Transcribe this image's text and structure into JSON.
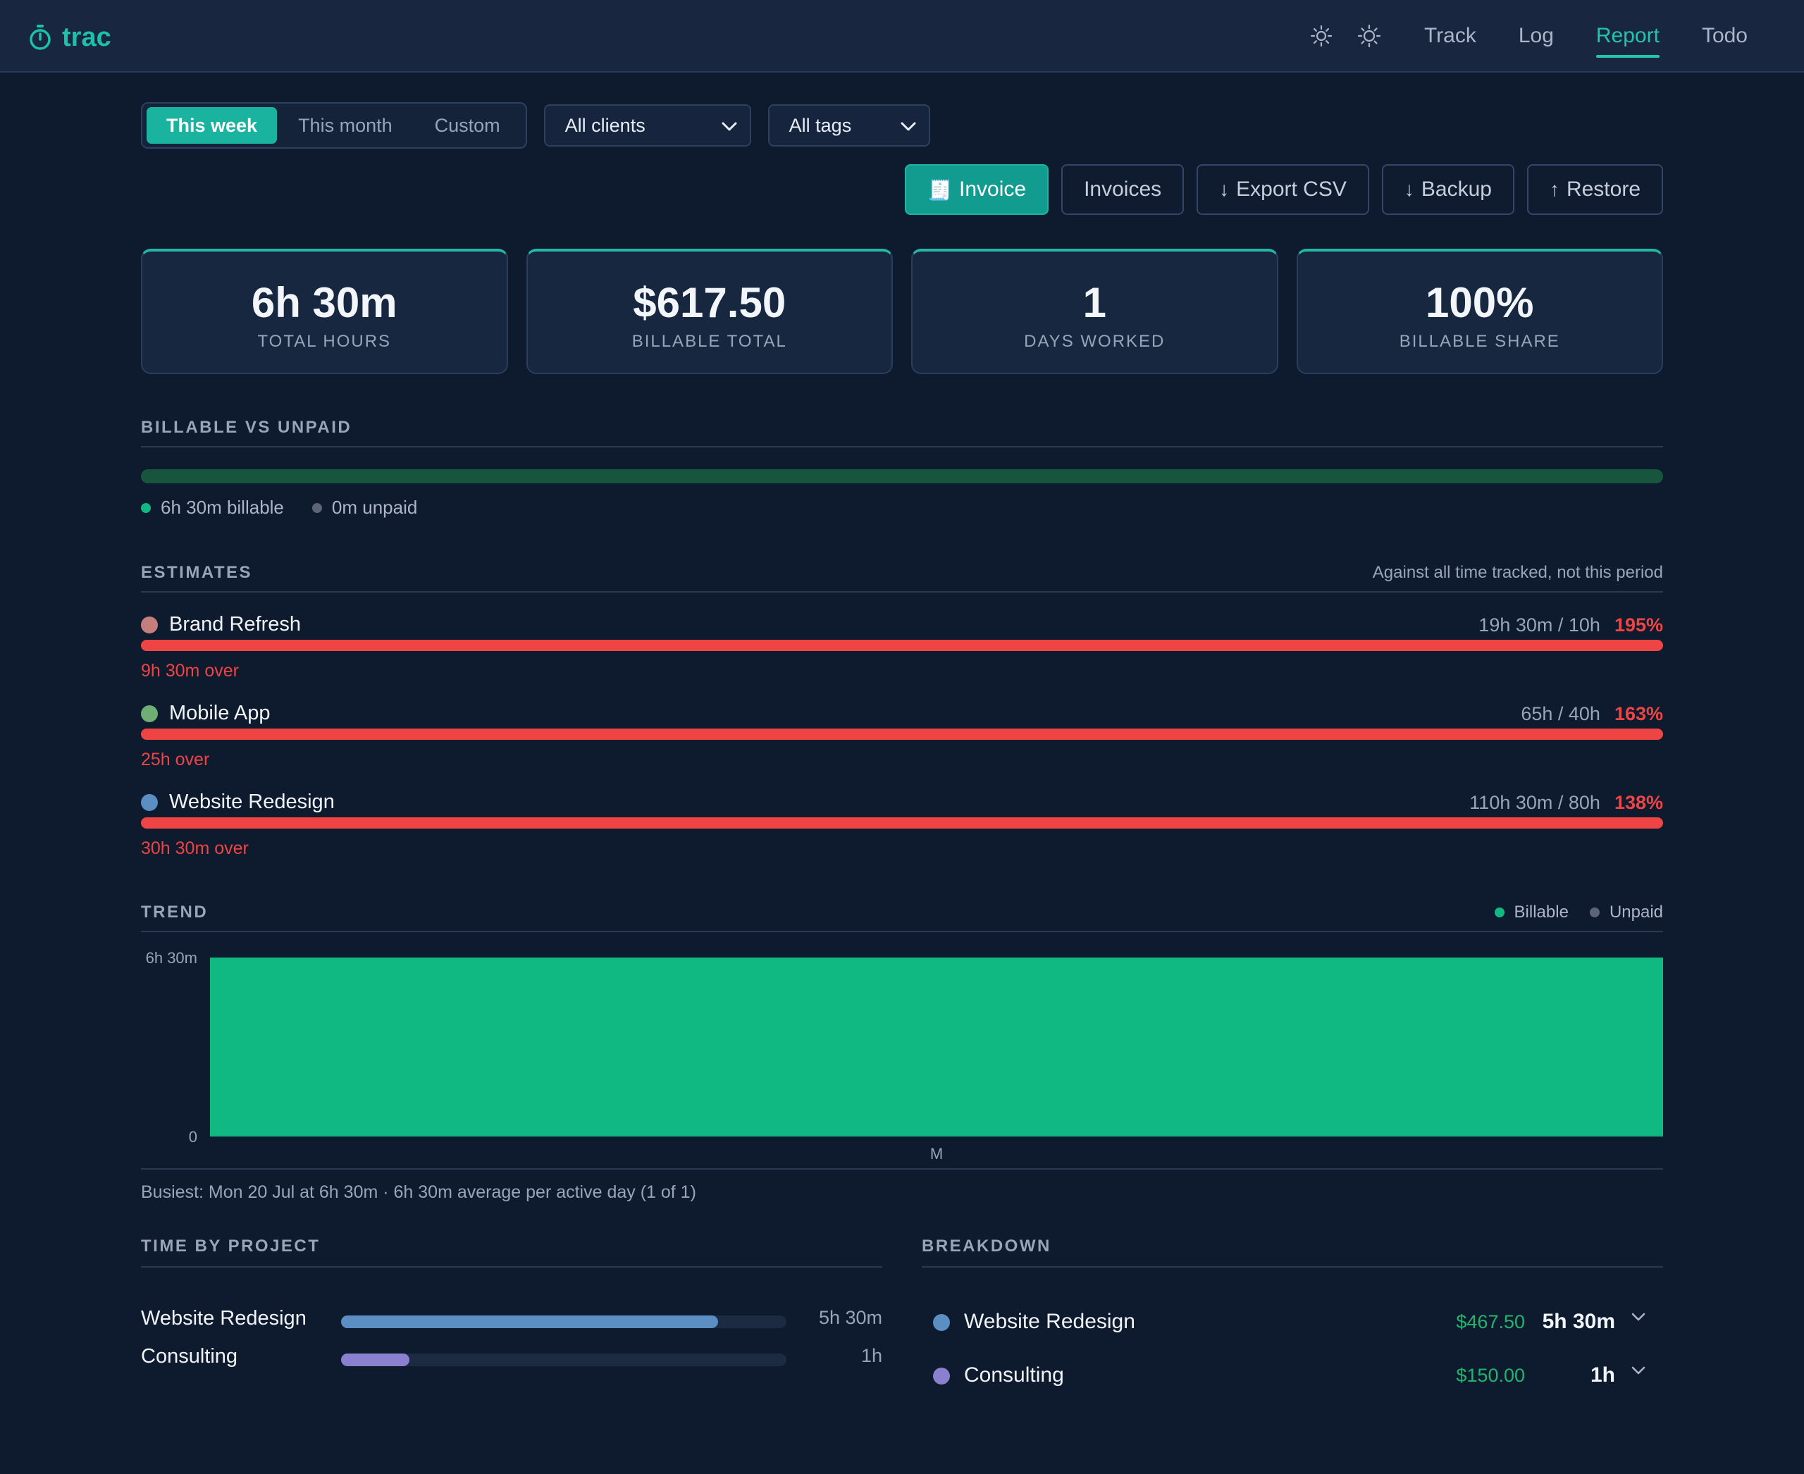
{
  "app": {
    "name": "trac",
    "accent": "#1dc0a8"
  },
  "nav": {
    "icons": [
      "sun-icon",
      "brightness-icon"
    ],
    "tabs": [
      {
        "label": "Track",
        "active": false
      },
      {
        "label": "Log",
        "active": false
      },
      {
        "label": "Report",
        "active": true
      },
      {
        "label": "Todo",
        "active": false
      }
    ]
  },
  "filters": {
    "period": [
      "This week",
      "This month",
      "Custom"
    ],
    "period_selected": "This week",
    "client": "All clients",
    "tag": "All tags"
  },
  "actions": {
    "invoice": "Invoice",
    "invoice_icon": "🧾",
    "invoices": "Invoices",
    "export": "Export CSV",
    "backup": "Backup",
    "restore": "Restore"
  },
  "stats": [
    {
      "value": "6h 30m",
      "label": "TOTAL HOURS"
    },
    {
      "value": "$617.50",
      "label": "BILLABLE TOTAL"
    },
    {
      "value": "1",
      "label": "DAYS WORKED"
    },
    {
      "value": "100%",
      "label": "BILLABLE SHARE"
    }
  ],
  "billable": {
    "title": "BILLABLE VS UNPAID",
    "billable_share": 1.0,
    "billable_label": "6h 30m billable",
    "unpaid_label": "0m unpaid",
    "billable_color": "#10b981",
    "unpaid_color": "#5b6575"
  },
  "estimates": {
    "title": "ESTIMATES",
    "note": "Against all time tracked, not this period",
    "items": [
      {
        "name": "Brand Refresh",
        "color": "#c47f7d",
        "ratio": "19h 30m / 10h",
        "pct": "195%",
        "over": "9h 30m over"
      },
      {
        "name": "Mobile App",
        "color": "#6fae74",
        "ratio": "65h / 40h",
        "pct": "163%",
        "over": "25h over"
      },
      {
        "name": "Website Redesign",
        "color": "#5b8fc4",
        "ratio": "110h 30m / 80h",
        "pct": "138%",
        "over": "30h 30m over"
      }
    ]
  },
  "trend": {
    "title": "TREND",
    "legend": [
      "Billable",
      "Unpaid"
    ],
    "summary": "Busiest: Mon 20 Jul at 6h 30m · 6h 30m average per active day (1 of 1)"
  },
  "chart_data": {
    "type": "bar",
    "categories": [
      "M"
    ],
    "series": [
      {
        "name": "Billable",
        "values": [
          6.5
        ]
      },
      {
        "name": "Unpaid",
        "values": [
          0
        ]
      }
    ],
    "y_tick_labels": [
      "0",
      "6h 30m"
    ],
    "ylim": [
      0,
      6.5
    ],
    "colors": {
      "Billable": "#10b981",
      "Unpaid": "#5b6575"
    },
    "legend": "top-right"
  },
  "projects": {
    "title": "TIME BY PROJECT",
    "items": [
      {
        "name": "Website Redesign",
        "value": "5h 30m",
        "share": 0.846,
        "color": "#5b8fc4"
      },
      {
        "name": "Consulting",
        "value": "1h",
        "share": 0.154,
        "color": "#8b7fd0"
      }
    ]
  },
  "breakdown": {
    "title": "BREAKDOWN",
    "items": [
      {
        "name": "Website Redesign",
        "amount": "$467.50",
        "hours": "5h 30m",
        "color": "#5b8fc4"
      },
      {
        "name": "Consulting",
        "amount": "$150.00",
        "hours": "1h",
        "color": "#8b7fd0"
      }
    ]
  }
}
